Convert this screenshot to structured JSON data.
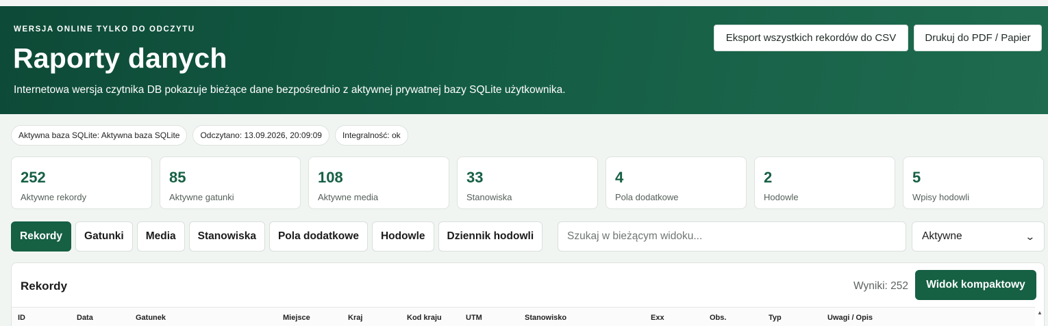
{
  "header": {
    "eyebrow": "WERSJA ONLINE TYLKO DO ODCZYTU",
    "title": "Raporty danych",
    "subtitle": "Internetowa wersja czytnika DB pokazuje bieżące dane bezpośrednio z aktywnej prywatnej bazy SQLite użytkownika.",
    "export_csv_label": "Eksport wszystkich rekordów do CSV",
    "print_pdf_label": "Drukuj do PDF / Papier"
  },
  "pills": [
    "Aktywna baza SQLite: Aktywna baza SQLite",
    "Odczytano: 13.09.2026, 20:09:09",
    "Integralność: ok"
  ],
  "stats": [
    {
      "value": "252",
      "label": "Aktywne rekordy"
    },
    {
      "value": "85",
      "label": "Aktywne gatunki"
    },
    {
      "value": "108",
      "label": "Aktywne media"
    },
    {
      "value": "33",
      "label": "Stanowiska"
    },
    {
      "value": "4",
      "label": "Pola dodatkowe"
    },
    {
      "value": "2",
      "label": "Hodowle"
    },
    {
      "value": "5",
      "label": "Wpisy hodowli"
    }
  ],
  "tabs": [
    {
      "label": "Rekordy",
      "active": true
    },
    {
      "label": "Gatunki"
    },
    {
      "label": "Media"
    },
    {
      "label": "Stanowiska"
    },
    {
      "label": "Pola dodatkowe"
    },
    {
      "label": "Hodowle"
    },
    {
      "label": "Dziennik hodowli"
    }
  ],
  "search": {
    "placeholder": "Szukaj w bieżącym widoku...",
    "value": ""
  },
  "filter": {
    "selected": "Aktywne"
  },
  "panel": {
    "title": "Rekordy",
    "results_text": "Wyniki: 252",
    "compact_label": "Widok kompaktowy",
    "columns": [
      "ID",
      "Data",
      "Gatunek",
      "Miejsce",
      "Kraj",
      "Kod kraju",
      "UTM",
      "Stanowisko",
      "Exx",
      "Obs.",
      "Typ",
      "Uwagi / Opis"
    ]
  },
  "colors": {
    "accent": "#166044",
    "header_dark": "#0d4a37",
    "header_light": "#1e6b4f"
  }
}
